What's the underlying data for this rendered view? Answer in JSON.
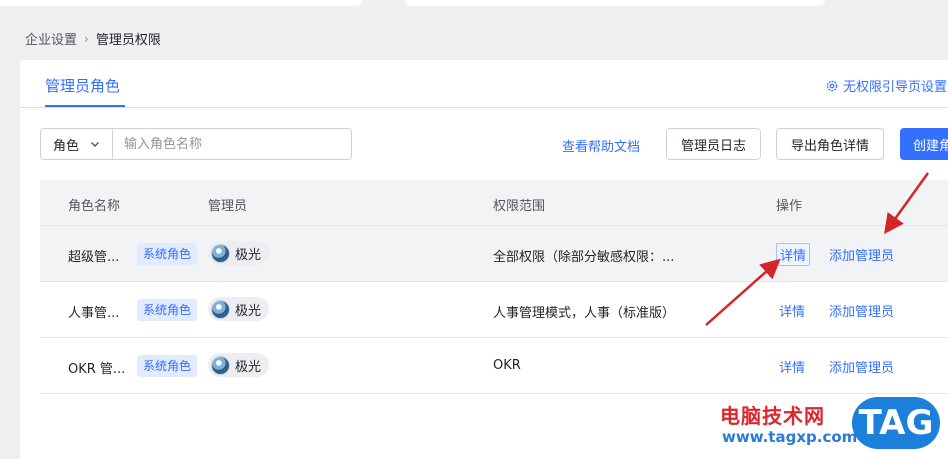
{
  "breadcrumb": {
    "parent": "企业设置",
    "separator": "›",
    "current": "管理员权限"
  },
  "tabs": {
    "active": "管理员角色"
  },
  "settings_link": {
    "icon": "gear-icon",
    "label": "无权限引导页设置"
  },
  "filter": {
    "select_value": "角色",
    "placeholder": "输入角色名称"
  },
  "toolbar": {
    "help_label": "查看帮助文档",
    "log_label": "管理员日志",
    "export_label": "导出角色详情",
    "create_label": "创建角"
  },
  "table": {
    "headers": {
      "name": "角色名称",
      "admin": "管理员",
      "scope": "权限范围",
      "ops": "操作"
    },
    "rows": [
      {
        "name": "超级管...",
        "badge": "系统角色",
        "admin": "极光",
        "scope": "全部权限（除部分敏感权限：...",
        "detail": "详情",
        "add": "添加管理员"
      },
      {
        "name": "人事管...",
        "badge": "系统角色",
        "admin": "极光",
        "scope": "人事管理模式，人事（标准版）",
        "detail": "详情",
        "add": "添加管理员"
      },
      {
        "name": "OKR 管...",
        "badge": "系统角色",
        "admin": "极光",
        "scope": "OKR",
        "detail": "详情",
        "add": "添加管理员"
      }
    ]
  },
  "watermark": {
    "cn": "电脑技术网",
    "url": "www.tagxp.com",
    "tag": "TAG"
  },
  "colors": {
    "accent": "#3370ff",
    "arrow": "#d4262a",
    "page_bg": "#eff0f2"
  }
}
